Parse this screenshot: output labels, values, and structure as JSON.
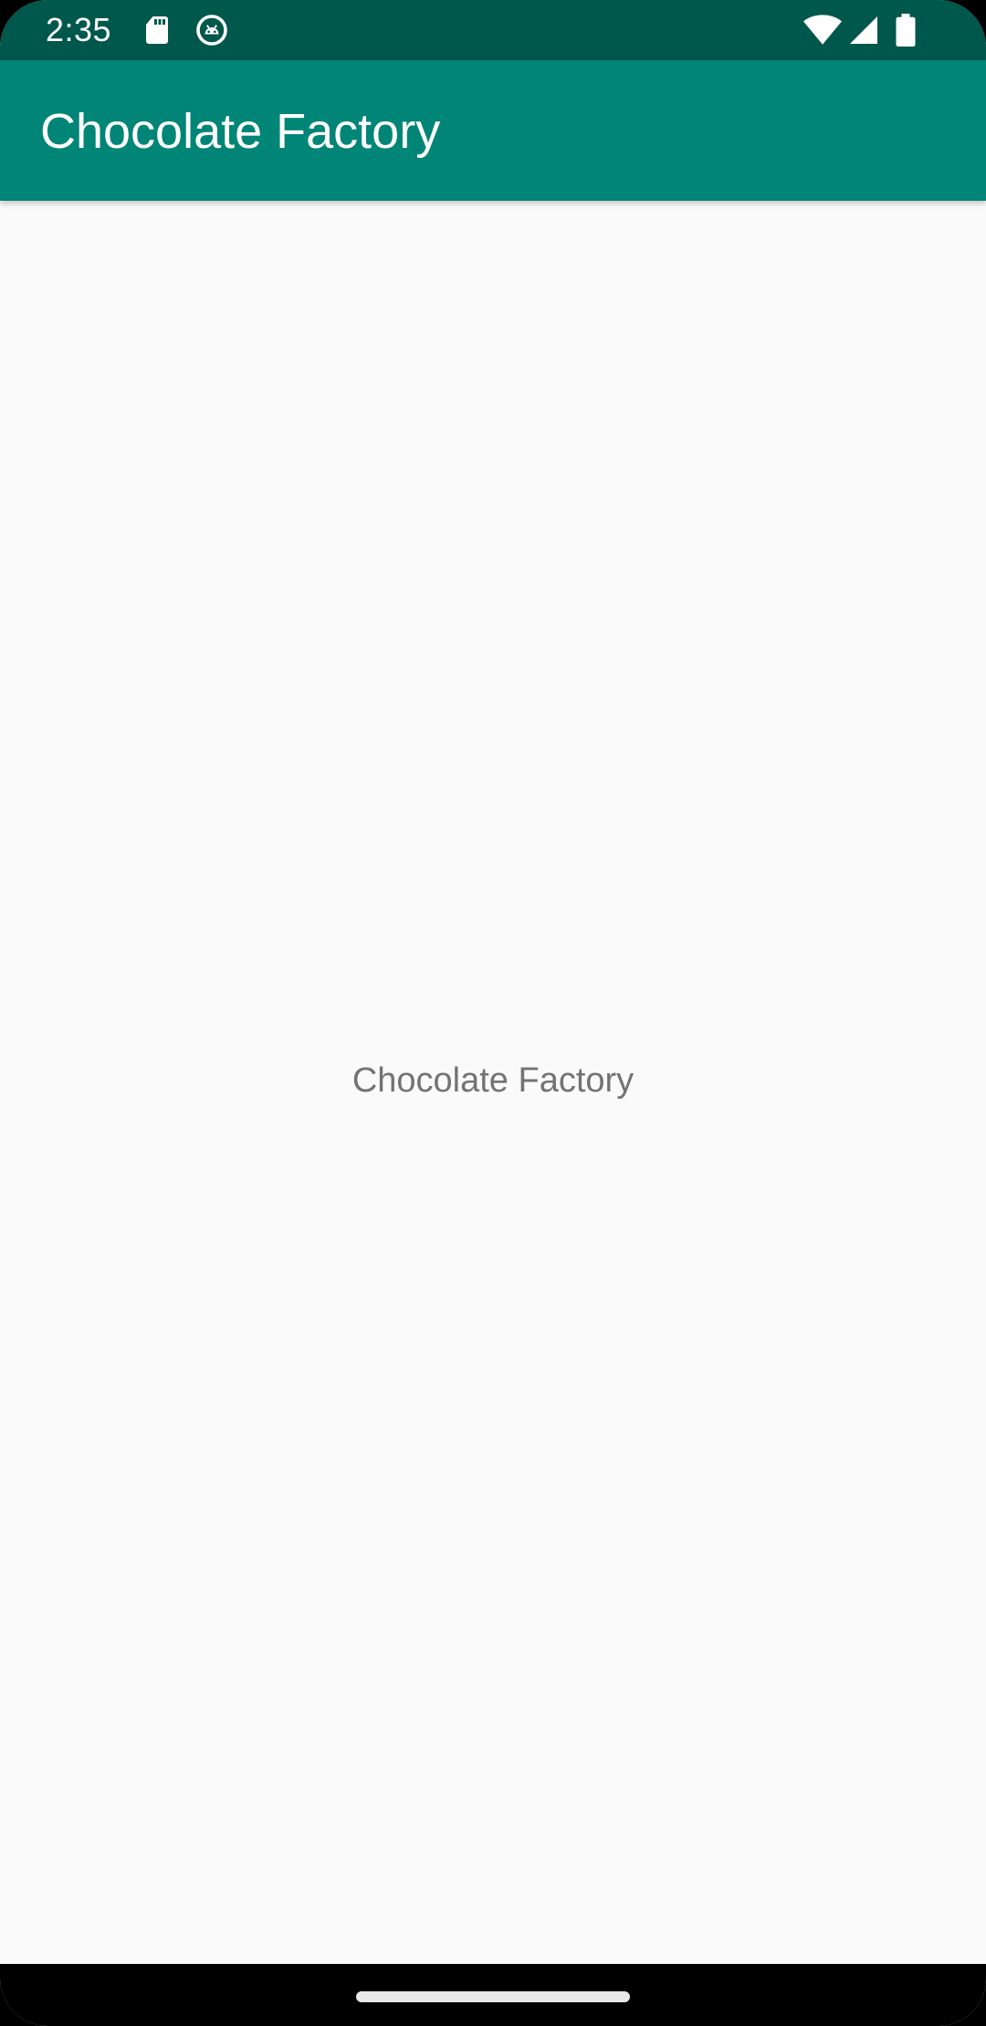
{
  "status_bar": {
    "time": "2:35",
    "icons": [
      "sd-card-icon",
      "android-debug-icon",
      "wifi-icon",
      "cell-signal-icon",
      "battery-icon"
    ],
    "color": "#00574b"
  },
  "app_bar": {
    "title": "Chocolate Factory",
    "color": "#008577"
  },
  "content": {
    "text": "Chocolate Factory",
    "background": "#fafafa"
  },
  "nav_bar": {
    "home_handle": "home-handle"
  }
}
